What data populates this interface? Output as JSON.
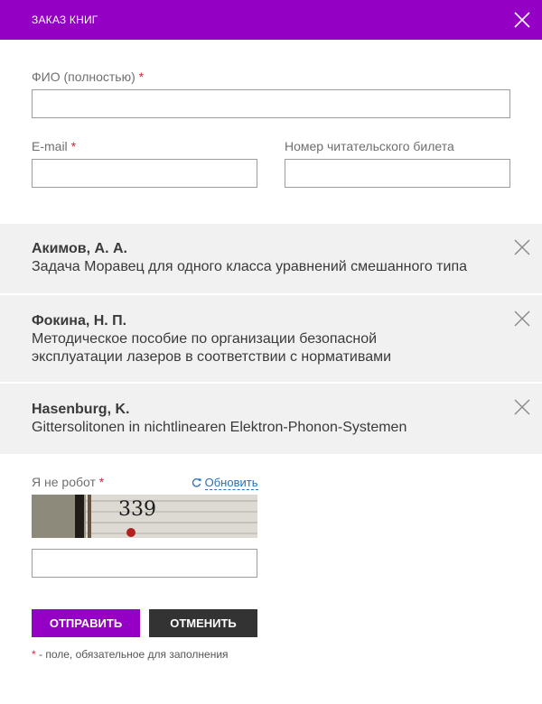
{
  "header": {
    "title": "ЗАКАЗ КНИГ"
  },
  "form": {
    "fio_label": "ФИО (полностью)",
    "required_mark": "*",
    "email_label": "E-mail",
    "ticket_label": "Номер читательского билета",
    "fio_value": "",
    "email_value": "",
    "ticket_value": ""
  },
  "books": [
    {
      "author": "Акимов, А. А.",
      "title": "Задача Моравец для одного класса уравнений смешанного типа"
    },
    {
      "author": "Фокина, Н. П.",
      "title": "Методическое пособие по организации безопасной эксплуатации лазеров в соответствии с нормативами"
    },
    {
      "author": "Hasenburg, K.",
      "title": "Gittersolitonen in nichtlinearen Elektron-Phonon-Systemen"
    }
  ],
  "captcha": {
    "label": "Я не робот",
    "refresh_label": "Обновить",
    "image_text": "339",
    "value": ""
  },
  "buttons": {
    "send": "ОТПРАВИТЬ",
    "cancel": "ОТМЕНИТЬ"
  },
  "footnote": {
    "mark": "*",
    "text": " - поле, обязательное для заполнения"
  },
  "colors": {
    "accent": "#9400c4",
    "dark_button": "#333333",
    "required": "#d3263b",
    "link": "#2a6fb8",
    "book_bg": "#f1f1f1"
  }
}
